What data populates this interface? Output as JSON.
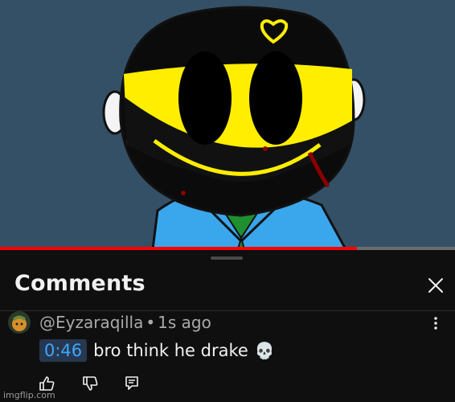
{
  "video": {
    "progress": 0.785
  },
  "comments_panel": {
    "title": "Comments"
  },
  "comment": {
    "author": "@Eyzaraqilla",
    "separator": "•",
    "time_ago": "1s ago",
    "timestamp": "0:46",
    "text": "bro think he drake",
    "emoji_icon": "skull-icon"
  },
  "actions": [
    "like-icon",
    "dislike-icon",
    "reply-icon"
  ],
  "watermark": "imgflip.com",
  "colors": {
    "progress": "#ff0000",
    "timestamp_link": "#3ea6ff",
    "timestamp_bg": "#263850",
    "panel_bg": "#0f0f0f",
    "video_bg": "#345066",
    "character_face": "#ffee00"
  }
}
